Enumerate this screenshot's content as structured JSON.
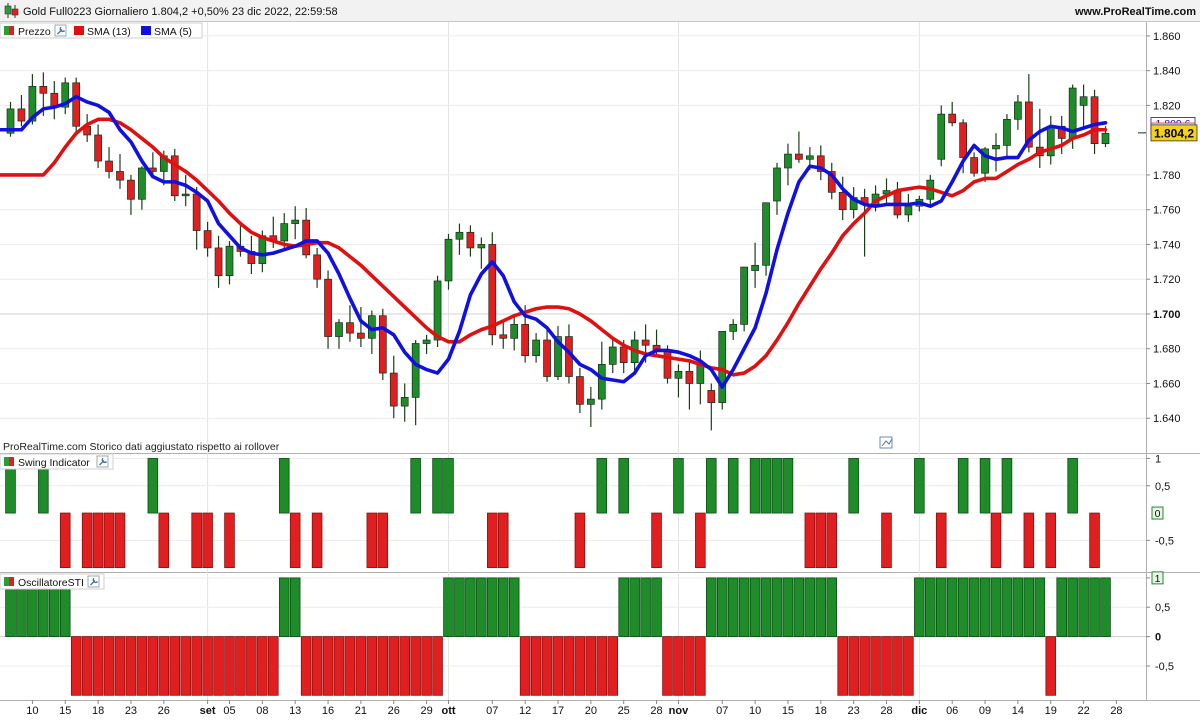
{
  "header": {
    "title": "Gold Full0223 Giornaliero 1.804,2 +0,50% 23 dic 2022, 22:59:58",
    "site": "www.ProRealTime.com",
    "footnote": "ProRealTime.com  Storico dati aggiustato rispetto ai rollover"
  },
  "colors": {
    "up": "#1f8c2a",
    "down": "#e02020",
    "sma13": "#e01010",
    "sma5": "#1010e0",
    "last_price_bg": "#f5d21a"
  },
  "chart_data": [
    {
      "type": "candlestick",
      "panel": "price",
      "legend": [
        {
          "label": "Prezzo",
          "icon": "red-green-square-icon"
        },
        {
          "label": "SMA (13)",
          "color": "#e01010"
        },
        {
          "label": "SMA (5)",
          "color": "#1010e0"
        }
      ],
      "ylim": [
        1.62,
        1.868
      ],
      "y_ticks": [
        {
          "v": 1.86,
          "t": "1.860"
        },
        {
          "v": 1.84,
          "t": "1.840"
        },
        {
          "v": 1.82,
          "t": "1.820"
        },
        {
          "v": 1.78,
          "t": "1.780"
        },
        {
          "v": 1.76,
          "t": "1.760"
        },
        {
          "v": 1.74,
          "t": "1.740"
        },
        {
          "v": 1.72,
          "t": "1.720"
        },
        {
          "v": 1.7,
          "t": "1.700",
          "bold": true
        },
        {
          "v": 1.68,
          "t": "1.680"
        },
        {
          "v": 1.66,
          "t": "1.660"
        },
        {
          "v": 1.64,
          "t": "1.640"
        }
      ],
      "price_labels": [
        {
          "v": 1.8096,
          "t": "1.809,6",
          "color": "#1010e0"
        },
        {
          "v": 1.8064,
          "t": "1.806,4",
          "color": "#e01010"
        },
        {
          "v": 1.8042,
          "t": "1.804,2",
          "last": true
        }
      ],
      "x_labels": [
        {
          "i": 2,
          "t": "10"
        },
        {
          "i": 5,
          "t": "15"
        },
        {
          "i": 8,
          "t": "18"
        },
        {
          "i": 11,
          "t": "23"
        },
        {
          "i": 14,
          "t": "26"
        },
        {
          "i": 18,
          "t": "set",
          "bold": true
        },
        {
          "i": 20,
          "t": "05"
        },
        {
          "i": 23,
          "t": "08"
        },
        {
          "i": 26,
          "t": "13"
        },
        {
          "i": 29,
          "t": "16"
        },
        {
          "i": 32,
          "t": "21"
        },
        {
          "i": 35,
          "t": "26"
        },
        {
          "i": 38,
          "t": "29"
        },
        {
          "i": 40,
          "t": "ott",
          "bold": true
        },
        {
          "i": 44,
          "t": "07"
        },
        {
          "i": 47,
          "t": "12"
        },
        {
          "i": 50,
          "t": "17"
        },
        {
          "i": 53,
          "t": "20"
        },
        {
          "i": 56,
          "t": "25"
        },
        {
          "i": 59,
          "t": "28"
        },
        {
          "i": 61,
          "t": "nov",
          "bold": true
        },
        {
          "i": 65,
          "t": "07"
        },
        {
          "i": 68,
          "t": "10"
        },
        {
          "i": 71,
          "t": "15"
        },
        {
          "i": 74,
          "t": "18"
        },
        {
          "i": 77,
          "t": "23"
        },
        {
          "i": 80,
          "t": "28"
        },
        {
          "i": 83,
          "t": "dic",
          "bold": true
        },
        {
          "i": 86,
          "t": "06"
        },
        {
          "i": 89,
          "t": "09"
        },
        {
          "i": 92,
          "t": "14"
        },
        {
          "i": 95,
          "t": "19"
        },
        {
          "i": 98,
          "t": "22"
        },
        {
          "i": 101,
          "t": "28"
        }
      ],
      "candles": [
        [
          1.804,
          1.822,
          1.802,
          1.818
        ],
        [
          1.818,
          1.826,
          1.808,
          1.811
        ],
        [
          1.811,
          1.838,
          1.809,
          1.831
        ],
        [
          1.831,
          1.839,
          1.814,
          1.827
        ],
        [
          1.827,
          1.834,
          1.812,
          1.819
        ],
        [
          1.819,
          1.836,
          1.815,
          1.833
        ],
        [
          1.833,
          1.836,
          1.805,
          1.808
        ],
        [
          1.808,
          1.815,
          1.799,
          1.803
        ],
        [
          1.803,
          1.809,
          1.784,
          1.788
        ],
        [
          1.788,
          1.796,
          1.778,
          1.782
        ],
        [
          1.782,
          1.792,
          1.772,
          1.777
        ],
        [
          1.777,
          1.78,
          1.757,
          1.766
        ],
        [
          1.766,
          1.785,
          1.76,
          1.784
        ],
        [
          1.784,
          1.793,
          1.779,
          1.782
        ],
        [
          1.782,
          1.794,
          1.774,
          1.791
        ],
        [
          1.791,
          1.795,
          1.765,
          1.768
        ],
        [
          1.768,
          1.78,
          1.762,
          1.769
        ],
        [
          1.769,
          1.773,
          1.737,
          1.748
        ],
        [
          1.748,
          1.753,
          1.733,
          1.738
        ],
        [
          1.738,
          1.745,
          1.715,
          1.722
        ],
        [
          1.722,
          1.742,
          1.717,
          1.739
        ],
        [
          1.739,
          1.752,
          1.733,
          1.736
        ],
        [
          1.736,
          1.745,
          1.723,
          1.729
        ],
        [
          1.729,
          1.748,
          1.724,
          1.745
        ],
        [
          1.745,
          1.756,
          1.738,
          1.742
        ],
        [
          1.742,
          1.758,
          1.736,
          1.752
        ],
        [
          1.752,
          1.762,
          1.743,
          1.754
        ],
        [
          1.754,
          1.761,
          1.732,
          1.734
        ],
        [
          1.734,
          1.738,
          1.715,
          1.72
        ],
        [
          1.72,
          1.725,
          1.68,
          1.687
        ],
        [
          1.687,
          1.697,
          1.68,
          1.695
        ],
        [
          1.695,
          1.705,
          1.684,
          1.689
        ],
        [
          1.689,
          1.704,
          1.681,
          1.686
        ],
        [
          1.686,
          1.702,
          1.677,
          1.699
        ],
        [
          1.699,
          1.703,
          1.662,
          1.666
        ],
        [
          1.666,
          1.676,
          1.64,
          1.647
        ],
        [
          1.647,
          1.66,
          1.638,
          1.652
        ],
        [
          1.652,
          1.685,
          1.636,
          1.683
        ],
        [
          1.683,
          1.688,
          1.677,
          1.685
        ],
        [
          1.685,
          1.722,
          1.681,
          1.719
        ],
        [
          1.719,
          1.746,
          1.714,
          1.743
        ],
        [
          1.743,
          1.752,
          1.734,
          1.747
        ],
        [
          1.747,
          1.751,
          1.733,
          1.738
        ],
        [
          1.738,
          1.744,
          1.726,
          1.74
        ],
        [
          1.74,
          1.747,
          1.682,
          1.688
        ],
        [
          1.688,
          1.696,
          1.68,
          1.686
        ],
        [
          1.686,
          1.7,
          1.679,
          1.694
        ],
        [
          1.694,
          1.705,
          1.672,
          1.676
        ],
        [
          1.676,
          1.689,
          1.672,
          1.685
        ],
        [
          1.685,
          1.691,
          1.661,
          1.664
        ],
        [
          1.664,
          1.693,
          1.662,
          1.687
        ],
        [
          1.687,
          1.694,
          1.66,
          1.664
        ],
        [
          1.664,
          1.669,
          1.643,
          1.648
        ],
        [
          1.648,
          1.658,
          1.635,
          1.651
        ],
        [
          1.651,
          1.684,
          1.645,
          1.671
        ],
        [
          1.671,
          1.685,
          1.666,
          1.681
        ],
        [
          1.681,
          1.685,
          1.666,
          1.672
        ],
        [
          1.672,
          1.69,
          1.666,
          1.685
        ],
        [
          1.685,
          1.694,
          1.672,
          1.682
        ],
        [
          1.682,
          1.691,
          1.675,
          1.679
        ],
        [
          1.679,
          1.682,
          1.66,
          1.663
        ],
        [
          1.663,
          1.671,
          1.652,
          1.667
        ],
        [
          1.667,
          1.674,
          1.645,
          1.66
        ],
        [
          1.66,
          1.679,
          1.648,
          1.671
        ],
        [
          1.656,
          1.66,
          1.633,
          1.649
        ],
        [
          1.649,
          1.69,
          1.645,
          1.69
        ],
        [
          1.69,
          1.697,
          1.685,
          1.694
        ],
        [
          1.694,
          1.727,
          1.69,
          1.727
        ],
        [
          1.725,
          1.741,
          1.715,
          1.728
        ],
        [
          1.728,
          1.764,
          1.722,
          1.764
        ],
        [
          1.765,
          1.787,
          1.757,
          1.784
        ],
        [
          1.784,
          1.798,
          1.774,
          1.792
        ],
        [
          1.792,
          1.805,
          1.787,
          1.789
        ],
        [
          1.789,
          1.796,
          1.783,
          1.791
        ],
        [
          1.791,
          1.797,
          1.777,
          1.782
        ],
        [
          1.782,
          1.787,
          1.766,
          1.77
        ],
        [
          1.77,
          1.779,
          1.754,
          1.76
        ],
        [
          1.76,
          1.773,
          1.755,
          1.767
        ],
        [
          1.767,
          1.772,
          1.733,
          1.763
        ],
        [
          1.763,
          1.774,
          1.759,
          1.769
        ],
        [
          1.769,
          1.778,
          1.764,
          1.771
        ],
        [
          1.771,
          1.776,
          1.755,
          1.757
        ],
        [
          1.757,
          1.769,
          1.753,
          1.762
        ],
        [
          1.762,
          1.768,
          1.759,
          1.766
        ],
        [
          1.766,
          1.78,
          1.762,
          1.777
        ],
        [
          1.789,
          1.82,
          1.785,
          1.815
        ],
        [
          1.815,
          1.822,
          1.808,
          1.81
        ],
        [
          1.81,
          1.812,
          1.781,
          1.79
        ],
        [
          1.79,
          1.793,
          1.779,
          1.781
        ],
        [
          1.781,
          1.796,
          1.776,
          1.795
        ],
        [
          1.795,
          1.804,
          1.782,
          1.797
        ],
        [
          1.797,
          1.815,
          1.79,
          1.812
        ],
        [
          1.812,
          1.826,
          1.806,
          1.822
        ],
        [
          1.822,
          1.838,
          1.793,
          1.796
        ],
        [
          1.796,
          1.818,
          1.784,
          1.791
        ],
        [
          1.791,
          1.814,
          1.786,
          1.808
        ],
        [
          1.808,
          1.814,
          1.792,
          1.801
        ],
        [
          1.801,
          1.832,
          1.795,
          1.83
        ],
        [
          1.82,
          1.832,
          1.806,
          1.825
        ],
        [
          1.825,
          1.829,
          1.792,
          1.798
        ],
        [
          1.798,
          1.808,
          1.796,
          1.804
        ]
      ],
      "sma13": [
        1.78,
        1.787,
        1.796,
        1.804,
        1.809,
        1.812,
        1.812,
        1.81,
        1.806,
        1.801,
        1.796,
        1.79,
        1.786,
        1.782,
        1.777,
        1.771,
        1.765,
        1.758,
        1.752,
        1.747,
        1.744,
        1.742,
        1.74,
        1.739,
        1.74,
        1.741,
        1.741,
        1.738,
        1.733,
        1.728,
        1.722,
        1.716,
        1.71,
        1.704,
        1.698,
        1.692,
        1.687,
        1.684,
        1.684,
        1.688,
        1.691,
        1.693,
        1.696,
        1.699,
        1.701,
        1.703,
        1.704,
        1.704,
        1.703,
        1.7,
        1.696,
        1.691,
        1.686,
        1.682,
        1.679,
        1.677,
        1.676,
        1.675,
        1.674,
        1.673,
        1.671,
        1.669,
        1.668,
        1.665,
        1.666,
        1.67,
        1.676,
        1.685,
        1.695,
        1.706,
        1.716,
        1.726,
        1.735,
        1.745,
        1.752,
        1.758,
        1.765,
        1.768,
        1.771,
        1.772,
        1.773,
        1.772,
        1.77,
        1.768,
        1.771,
        1.776,
        1.778,
        1.778,
        1.782,
        1.786,
        1.789,
        1.793,
        1.795,
        1.797,
        1.801,
        1.803,
        1.806,
        1.806
      ],
      "sma5": [
        1.806,
        1.813,
        1.818,
        1.819,
        1.821,
        1.825,
        1.822,
        1.82,
        1.816,
        1.806,
        1.799,
        1.788,
        1.779,
        1.776,
        1.776,
        1.774,
        1.77,
        1.765,
        1.752,
        1.745,
        1.738,
        1.735,
        1.734,
        1.735,
        1.737,
        1.739,
        1.742,
        1.742,
        1.735,
        1.723,
        1.709,
        1.696,
        1.691,
        1.692,
        1.688,
        1.678,
        1.671,
        1.668,
        1.666,
        1.674,
        1.69,
        1.711,
        1.723,
        1.73,
        1.722,
        1.707,
        1.699,
        1.697,
        1.692,
        1.684,
        1.678,
        1.671,
        1.668,
        1.663,
        1.662,
        1.661,
        1.666,
        1.676,
        1.679,
        1.679,
        1.678,
        1.676,
        1.673,
        1.668,
        1.658,
        1.668,
        1.68,
        1.692,
        1.712,
        1.737,
        1.758,
        1.776,
        1.785,
        1.784,
        1.78,
        1.772,
        1.766,
        1.763,
        1.762,
        1.763,
        1.763,
        1.763,
        1.764,
        1.762,
        1.765,
        1.776,
        1.788,
        1.797,
        1.791,
        1.789,
        1.79,
        1.79,
        1.8,
        1.805,
        1.808,
        1.807,
        1.805,
        1.807,
        1.809,
        1.81
      ]
    },
    {
      "type": "bar",
      "panel": "swing",
      "legend": [
        {
          "label": "Swing Indicator",
          "icon": "red-green-square-icon"
        }
      ],
      "ylim": [
        -1.08,
        1.1
      ],
      "y_ticks": [
        {
          "v": 1,
          "t": "1"
        },
        {
          "v": 0.5,
          "t": "0,5"
        },
        {
          "v": -0.5,
          "t": "-0,5"
        }
      ],
      "last_value": {
        "v": 0,
        "t": "0"
      },
      "values": [
        1,
        0,
        0,
        1,
        0,
        -1,
        0,
        -1,
        -1,
        -1,
        -1,
        0,
        0,
        1,
        -1,
        0,
        0,
        -1,
        -1,
        0,
        -1,
        0,
        0,
        0,
        0,
        1,
        -1,
        0,
        -1,
        0,
        0,
        0,
        0,
        -1,
        -1,
        0,
        0,
        1,
        0,
        1,
        1,
        0,
        0,
        0,
        -1,
        -1,
        0,
        0,
        0,
        0,
        0,
        0,
        -1,
        0,
        1,
        0,
        1,
        0,
        0,
        -1,
        0,
        1,
        0,
        -1,
        1,
        0,
        1,
        0,
        1,
        1,
        1,
        1,
        0,
        -1,
        -1,
        -1,
        0,
        1,
        0,
        0,
        -1,
        0,
        0,
        1,
        0,
        -1,
        0,
        1,
        0,
        1,
        -1,
        1,
        0,
        -1,
        0,
        -1,
        0,
        1,
        0,
        -1,
        0
      ]
    },
    {
      "type": "bar",
      "panel": "oscillator",
      "legend": [
        {
          "label": "OscillatoreSTI",
          "icon": "red-green-square-icon"
        }
      ],
      "ylim": [
        -1.08,
        1.1
      ],
      "y_ticks": [
        {
          "v": 1,
          "t": "1"
        },
        {
          "v": 0.5,
          "t": "0,5"
        },
        {
          "v": 0,
          "t": "0",
          "bold": true
        },
        {
          "v": -0.5,
          "t": "-0,5"
        }
      ],
      "last_value": {
        "v": 1,
        "t": "1"
      },
      "values": [
        1,
        1,
        1,
        1,
        1,
        1,
        -1,
        -1,
        -1,
        -1,
        -1,
        -1,
        -1,
        -1,
        -1,
        -1,
        -1,
        -1,
        -1,
        -1,
        -1,
        -1,
        -1,
        -1,
        -1,
        1,
        1,
        -1,
        -1,
        -1,
        -1,
        -1,
        -1,
        -1,
        -1,
        -1,
        -1,
        -1,
        -1,
        -1,
        1,
        1,
        1,
        1,
        1,
        1,
        1,
        -1,
        -1,
        -1,
        -1,
        -1,
        -1,
        -1,
        -1,
        -1,
        1,
        1,
        1,
        1,
        -1,
        -1,
        -1,
        -1,
        1,
        1,
        1,
        1,
        1,
        1,
        1,
        1,
        1,
        1,
        1,
        1,
        -1,
        -1,
        -1,
        -1,
        -1,
        -1,
        -1,
        1,
        1,
        1,
        1,
        1,
        1,
        1,
        1,
        1,
        1,
        1,
        1,
        -1,
        1,
        1,
        1,
        1,
        1
      ]
    }
  ]
}
